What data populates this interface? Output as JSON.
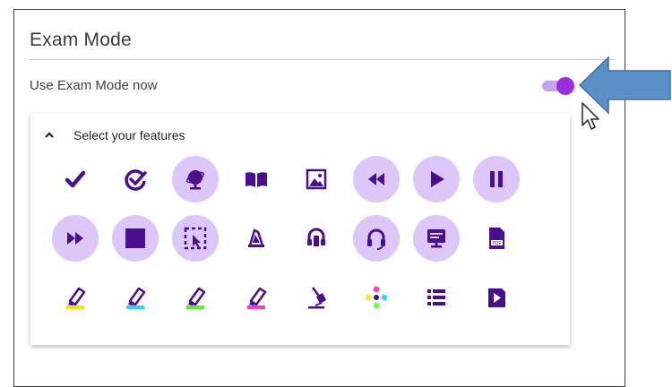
{
  "settings": {
    "title": "Exam Mode",
    "toggle_label": "Use Exam Mode now",
    "toggle_on": true
  },
  "features": {
    "header_label": "Select your features",
    "expanded": true,
    "items": [
      {
        "icon": "checkmark-icon",
        "active": false
      },
      {
        "icon": "check-circle-icon",
        "active": false
      },
      {
        "icon": "globe-icon",
        "active": true
      },
      {
        "icon": "book-icon",
        "active": false
      },
      {
        "icon": "picture-icon",
        "active": false
      },
      {
        "icon": "rewind-icon",
        "active": true
      },
      {
        "icon": "play-icon",
        "active": true
      },
      {
        "icon": "pause-icon",
        "active": true
      },
      {
        "icon": "fast-forward-icon",
        "active": true
      },
      {
        "icon": "stop-icon",
        "active": true
      },
      {
        "icon": "select-cursor-icon",
        "active": true
      },
      {
        "icon": "practice-reader-icon",
        "active": false
      },
      {
        "icon": "audio-maker-icon",
        "active": false
      },
      {
        "icon": "headphones-icon",
        "active": true
      },
      {
        "icon": "screen-monitor-icon",
        "active": true
      },
      {
        "icon": "pdf-icon",
        "active": false
      },
      {
        "icon": "highlighter-yellow-icon",
        "active": false
      },
      {
        "icon": "highlighter-cyan-icon",
        "active": false
      },
      {
        "icon": "highlighter-green-icon",
        "active": false
      },
      {
        "icon": "highlighter-pink-icon",
        "active": false
      },
      {
        "icon": "clear-highlights-icon",
        "active": false
      },
      {
        "icon": "collect-highlights-icon",
        "active": false
      },
      {
        "icon": "list-icon",
        "active": false
      },
      {
        "icon": "play-box-icon",
        "active": false
      }
    ]
  },
  "colors": {
    "icon": "#4a0f8c",
    "active_bg": "#ddc7f9",
    "toggle_knob": "#9b2fe0",
    "toggle_track": "#c8a0f2",
    "annotation_arrow": "#5b8fc8"
  }
}
